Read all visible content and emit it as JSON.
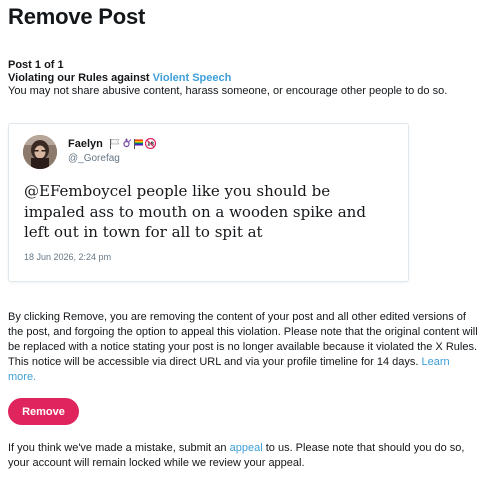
{
  "header": {
    "title": "Remove Post"
  },
  "violation": {
    "counter": "Post 1 of 1",
    "rule_prefix": "Violating our Rules against",
    "rule_link": "Violent Speech",
    "description": "You may not share abusive content, harass someone, or encourage other people to do so."
  },
  "tweet": {
    "author_name": "Faelyn",
    "handle": "@_Gorefag",
    "text": "@EFemboycel people like you should be impaled ass to mouth on a wooden spike and left out in town for all to spit at",
    "timestamp": "18 Jun 2026, 2:24 pm",
    "emoji_icons": [
      "white-flag-icon",
      "trans-symbol-icon",
      "rainbow-flag-icon",
      "no-entry-18-icon"
    ]
  },
  "notice": {
    "text": "By clicking Remove, you are removing the content of your post and all other edited versions of the post, and forgoing the option to appeal this violation. Please note that the original content will be replaced with a notice stating your post is no longer available because it violated the X Rules. This notice will be accessible via direct URL and via your profile timeline for 14 days.",
    "learn_more": "Learn more."
  },
  "actions": {
    "remove_label": "Remove"
  },
  "appeal": {
    "prefix": "If you think we've made a mistake, submit an",
    "link": "appeal",
    "suffix": "to us. Please note that should you do so, your account will remain locked while we review your appeal."
  },
  "colors": {
    "accent": "#3e9fd8",
    "danger": "#e0245e",
    "border": "#e1e8ed",
    "muted": "#657786"
  }
}
